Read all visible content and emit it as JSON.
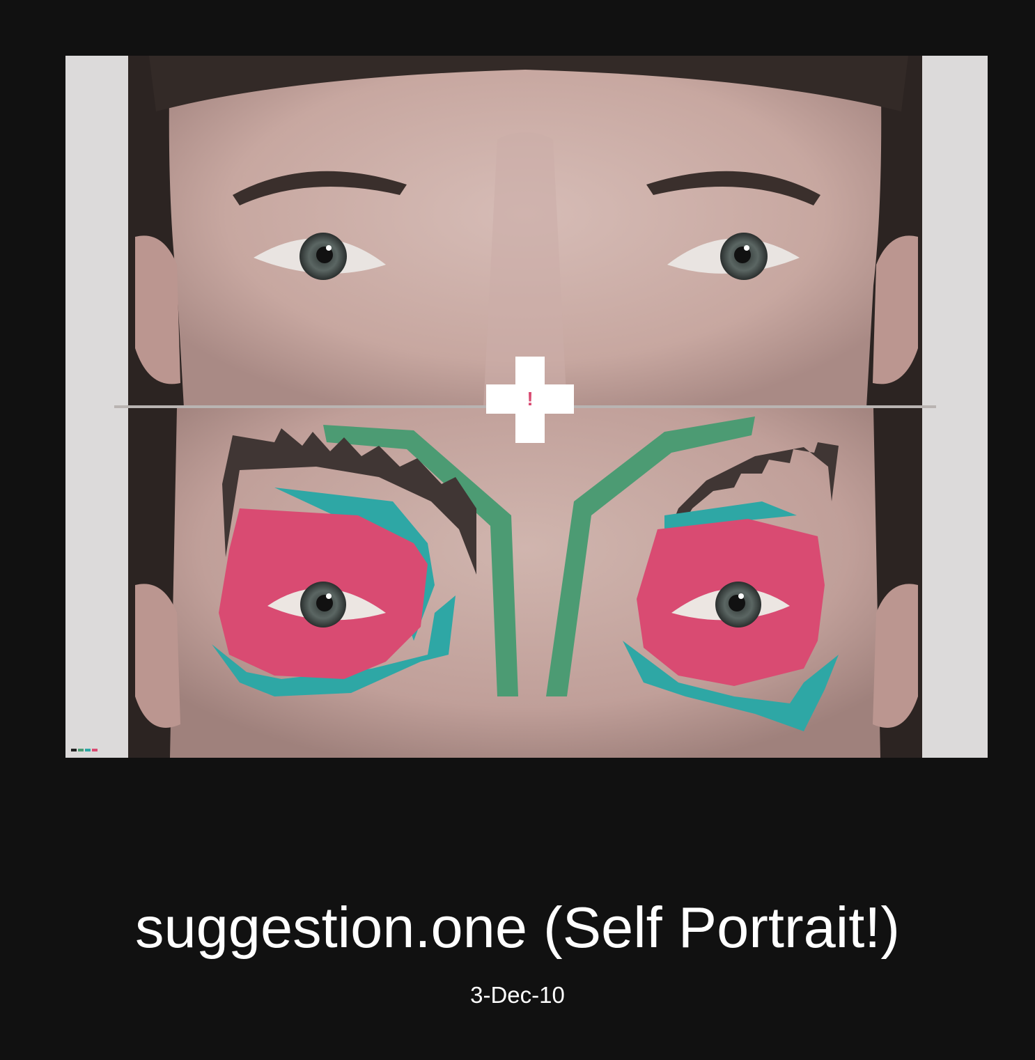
{
  "post": {
    "title": "suggestion.one (Self Portrait!)",
    "date": "3-Dec-10"
  },
  "artwork": {
    "badge_symbol": "!",
    "colors": {
      "background": "#111111",
      "pink": "#d94b72",
      "teal": "#2ea7a5",
      "green": "#4c9b73",
      "brow": "#403634"
    }
  }
}
